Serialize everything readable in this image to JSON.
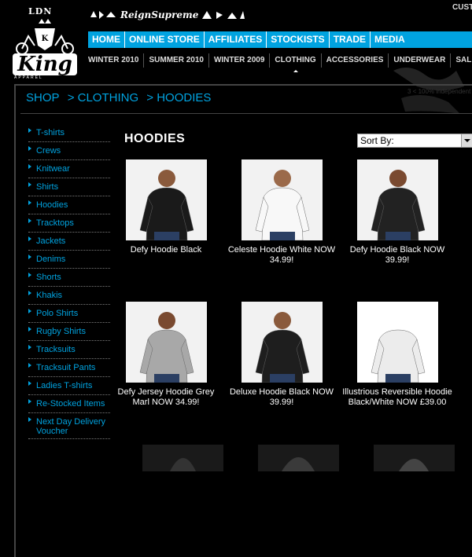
{
  "logo": {
    "ldn": "LDN",
    "king": "King",
    "apparel": "APPAREL"
  },
  "tagline": "ReignSupreme",
  "top_right": "CUST",
  "main_nav": [
    "HOME",
    "ONLINE STORE",
    "AFFILIATES",
    "STOCKISTS",
    "TRADE",
    "MEDIA"
  ],
  "sub_nav": [
    "WINTER 2010",
    "SUMMER 2010",
    "WINTER 2009",
    "CLOTHING",
    "ACCESSORIES",
    "UNDERWEAR",
    "SALE"
  ],
  "sub_nav_active": "CLOTHING",
  "bg_text": "3 < 100% independent",
  "breadcrumb": [
    "SHOP",
    "> CLOTHING",
    "> HOODIES"
  ],
  "sidebar": [
    "T-shirts",
    "Crews",
    "Knitwear",
    "Shirts",
    "Hoodies",
    "Tracktops",
    "Jackets",
    "Denims",
    "Shorts",
    "Khakis",
    "Polo Shirts",
    "Rugby Shirts",
    "Tracksuits",
    "Tracksuit Pants",
    "Ladies T-shirts",
    "Re-Stocked Items",
    "Next Day Delivery Voucher"
  ],
  "page_title": "HOODIES",
  "sort_by": "Sort By:",
  "products": [
    {
      "name": "Defy Hoodie Black",
      "colors": {
        "bg": "#f2f2f2",
        "garment": "#1a1a1a",
        "skin": "#8a5a3c"
      }
    },
    {
      "name": "Celeste Hoodie White NOW 34.99!",
      "colors": {
        "bg": "#f2f2f2",
        "garment": "#f8f8f8",
        "skin": "#9b6a4a"
      }
    },
    {
      "name": "Defy Hoodie Black NOW 39.99!",
      "colors": {
        "bg": "#f2f2f2",
        "garment": "#222222",
        "skin": "#7a4a30"
      }
    },
    {
      "name": "Defy Jersey Hoodie Grey Marl NOW 34.99!",
      "colors": {
        "bg": "#f2f2f2",
        "garment": "#a8a8a8",
        "skin": "#7a4a30"
      }
    },
    {
      "name": "Deluxe Hoodie Black NOW 39.99!",
      "colors": {
        "bg": "#f2f2f2",
        "garment": "#1e1e1e",
        "skin": "#8a5a3c"
      }
    },
    {
      "name": "Illustrious Reversible Hoodie Black/White NOW £39.00",
      "colors": {
        "bg": "#ffffff",
        "garment": "#ececec",
        "skin": "#ffffff"
      }
    }
  ],
  "accent_color": "#00a3e0"
}
